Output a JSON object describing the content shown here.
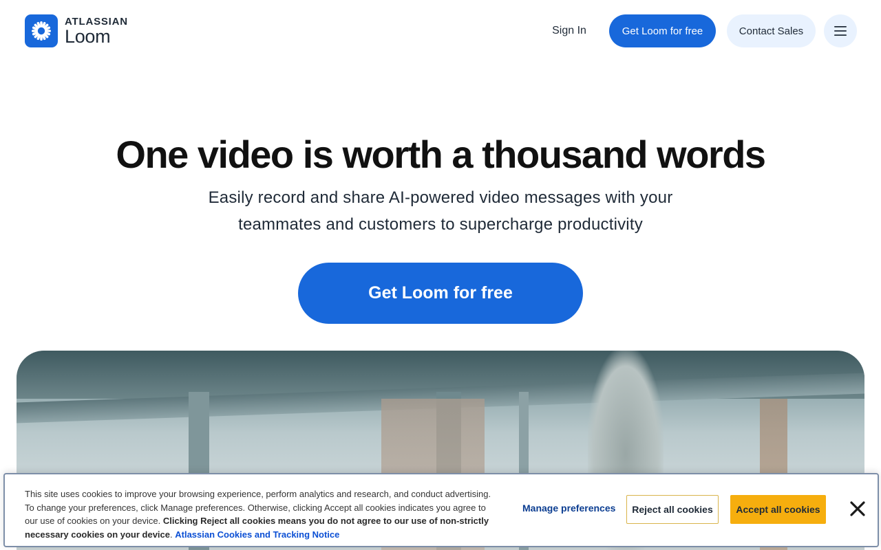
{
  "header": {
    "logo": {
      "brand": "ATLASSIAN",
      "product": "Loom",
      "icon": "loom-starburst-icon",
      "accent": "#1868db"
    },
    "signin_label": "Sign In",
    "get_loom_label": "Get Loom for free",
    "contact_sales_label": "Contact Sales",
    "menu_icon": "hamburger-menu-icon"
  },
  "hero": {
    "title": "One video is worth a thousand words",
    "subtitle": "Easily record and share AI-powered video messages with your teammates and customers to supercharge productivity",
    "cta_label": "Get Loom for free"
  },
  "cookie_banner": {
    "text_plain": "This site uses cookies to improve your browsing experience, perform analytics and research, and conduct advertising. To change your preferences, click Manage preferences. Otherwise, clicking Accept all cookies indicates you agree to our use of cookies on your device.",
    "text_bold": "Clicking Reject all cookies means you do not agree to our use of non-strictly necessary cookies on your device",
    "text_period": ".",
    "link_label": "Atlassian Cookies and Tracking Notice",
    "manage_label": "Manage preferences",
    "reject_label": "Reject all cookies",
    "accept_label": "Accept all cookies",
    "close_icon": "close-icon",
    "accept_color": "#f6ae0e"
  }
}
